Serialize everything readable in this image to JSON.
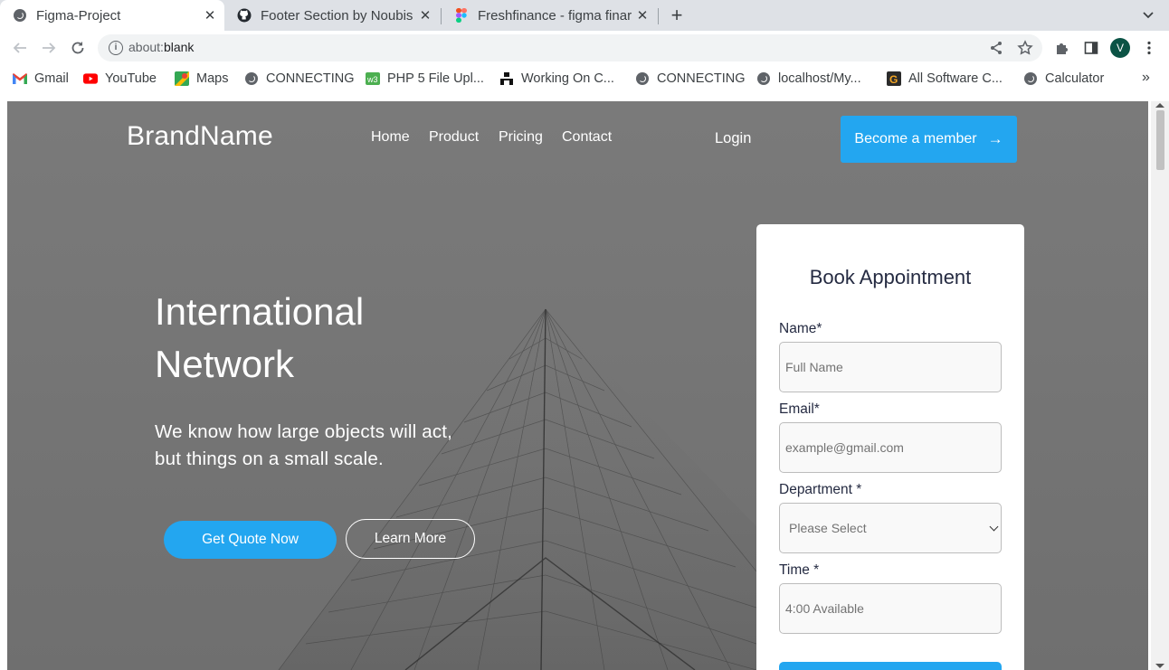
{
  "browser": {
    "tabs": [
      {
        "title": "Figma-Project",
        "icon": "globe-icon",
        "active": true
      },
      {
        "title": "Footer Section by Noubis",
        "icon": "github-icon",
        "active": false
      },
      {
        "title": "Freshfinance - figma finar",
        "icon": "figma-icon",
        "active": false
      }
    ],
    "close_glyph": "✕",
    "new_tab_glyph": "+",
    "url_scheme": "about:",
    "url_path": "blank",
    "profile_initial": "V",
    "bookmarks": [
      {
        "label": "Gmail",
        "icon": "gmail-icon"
      },
      {
        "label": "YouTube",
        "icon": "youtube-icon"
      },
      {
        "label": "Maps",
        "icon": "maps-icon"
      },
      {
        "label": "CONNECTING",
        "icon": "globe-icon"
      },
      {
        "label": "PHP 5 File Upl...",
        "icon": "w3schools-icon"
      },
      {
        "label": "Working On C...",
        "icon": "bookmark-site-icon"
      },
      {
        "label": "CONNECTING",
        "icon": "globe-icon"
      },
      {
        "label": "localhost/My...",
        "icon": "globe-icon"
      },
      {
        "label": "All Software C...",
        "icon": "software-icon"
      },
      {
        "label": "Calculator",
        "icon": "globe-icon"
      }
    ],
    "bookmarks_overflow": "»"
  },
  "colors": {
    "accent": "#23a6f0",
    "hero_overlay": "#7a7a7a",
    "heading": "#252b42"
  },
  "site": {
    "brand": "BrandName",
    "nav": [
      "Home",
      "Product",
      "Pricing",
      "Contact"
    ],
    "login": "Login",
    "cta": "Become a member",
    "cta_arrow": "→",
    "hero": {
      "title_line1": "International",
      "title_line2": "Network",
      "sub_line1": "We know how large objects will act,",
      "sub_line2": "but things on a small scale.",
      "primary_button": "Get Quote Now",
      "secondary_button": "Learn More"
    },
    "form": {
      "title": "Book Appointment",
      "name_label": "Name*",
      "name_placeholder": "Full Name",
      "email_label": "Email*",
      "email_placeholder": "example@gmail.com",
      "department_label": "Department *",
      "department_value": "Please Select",
      "time_label": "Time *",
      "time_value": "4:00 Available"
    }
  }
}
